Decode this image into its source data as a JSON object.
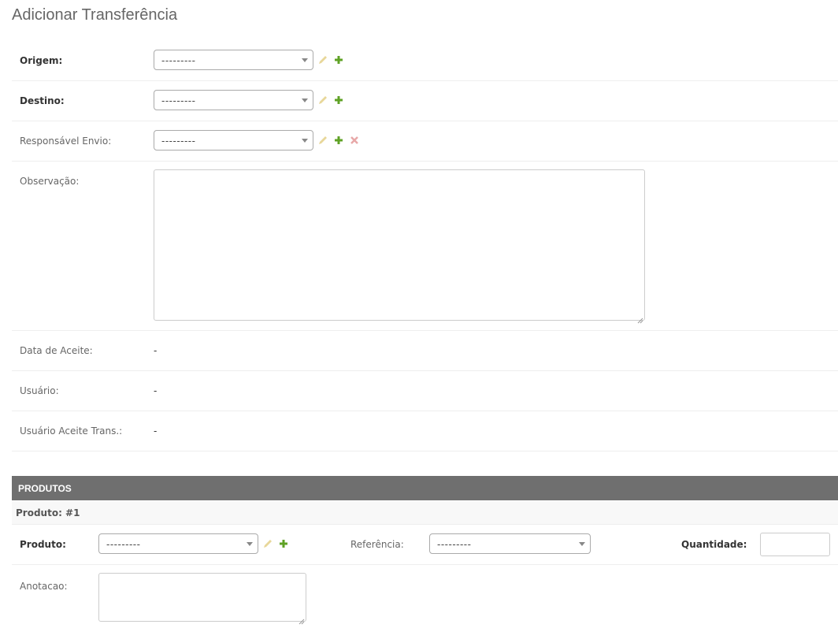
{
  "page_title": "Adicionar Transferência",
  "fields": {
    "origem": {
      "label": "Origem:",
      "value": "---------"
    },
    "destino": {
      "label": "Destino:",
      "value": "---------"
    },
    "responsavel": {
      "label": "Responsável Envio:",
      "value": "---------"
    },
    "observacao": {
      "label": "Observação:",
      "value": ""
    },
    "data_aceite": {
      "label": "Data de Aceite:",
      "value": "-"
    },
    "usuario": {
      "label": "Usuário:",
      "value": "-"
    },
    "usuario_aceite": {
      "label": "Usuário Aceite Trans.:",
      "value": "-"
    }
  },
  "inline": {
    "title": "PRODUTOS",
    "item_title": "Produto: #1",
    "produto": {
      "label": "Produto:",
      "value": "---------"
    },
    "referencia": {
      "label": "Referência:",
      "value": "---------"
    },
    "quantidade": {
      "label": "Quantidade:",
      "value": ""
    },
    "anotacao": {
      "label": "Anotacao:",
      "value": ""
    }
  },
  "icons": {
    "edit": "pencil-icon",
    "add": "plus-icon",
    "delete": "x-icon"
  },
  "colors": {
    "add": "#5fa225",
    "edit": "#e8d79a",
    "delete": "#e8a8a8",
    "header": "#6f6f6f"
  }
}
